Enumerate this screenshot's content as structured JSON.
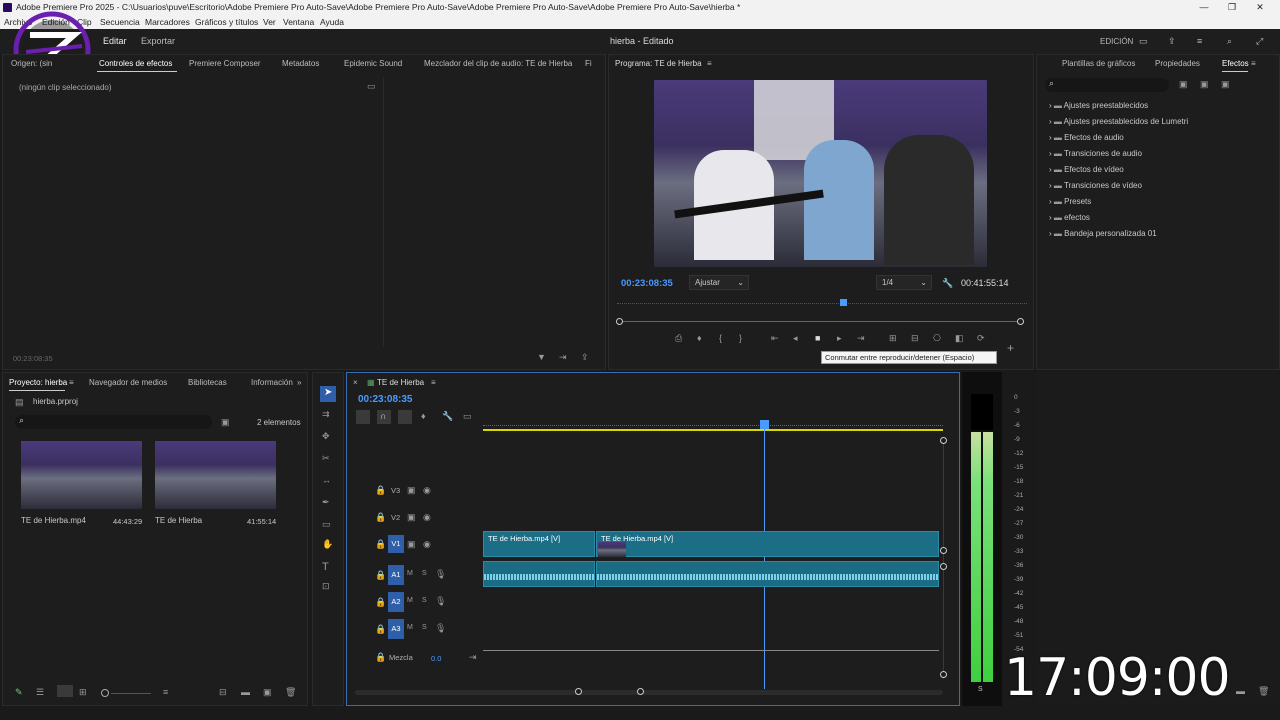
{
  "window": {
    "title": "Adobe Premiere Pro 2025 - C:\\Usuarios\\puve\\Escritorio\\Adobe Premiere Pro Auto-Save\\Adobe Premiere Pro Auto-Save\\Adobe Premiere Pro Auto-Save\\Adobe Premiere Pro Auto-Save\\hierba *",
    "minimize": "—",
    "maximize": "❐",
    "close": "✕"
  },
  "menu": [
    "Archivo",
    "Edición",
    "Clip",
    "Secuencia",
    "Marcadores",
    "Gráficos y títulos",
    "Ver",
    "Ventana",
    "Ayuda"
  ],
  "header": {
    "edit": "Editar",
    "export": "Exportar",
    "project_title": "hierba - Editado",
    "workspace": "EDICIÓN"
  },
  "source_panel": {
    "tabs": [
      "Origen: (sin",
      "Controles de efectos",
      "Premiere Composer",
      "Metadatos",
      "Epidemic Sound",
      "Mezclador del clip de audio: TE de Hierba",
      "Fi"
    ],
    "empty_label": "(ningún clip seleccionado)",
    "timecode": "00:23:08:35"
  },
  "program_monitor": {
    "title": "Programa: TE de Hierba",
    "timecode": "00:23:08:35",
    "fit": "Ajustar",
    "resolution": "1/4",
    "duration": "00:41:55:14",
    "playhead_fraction": 0.55,
    "tooltip": "Conmutar entre reproducir/detener (Espacio)"
  },
  "effects_panel": {
    "tabs": [
      "Plantillas de gráficos",
      "Propiedades",
      "Efectos"
    ],
    "items": [
      "Ajustes preestablecidos",
      "Ajustes preestablecidos de Lumetri",
      "Efectos de audio",
      "Transiciones de audio",
      "Efectos de vídeo",
      "Transiciones de vídeo",
      "Presets",
      "efectos",
      "Bandeja personalizada 01"
    ]
  },
  "project_panel": {
    "tabs": [
      "Proyecto: hierba",
      "Navegador de medios",
      "Bibliotecas",
      "Información"
    ],
    "file": "hierba.prproj",
    "count": "2 elementos",
    "items": [
      {
        "name": "TE de Hierba.mp4",
        "duration": "44:43:29"
      },
      {
        "name": "TE de Hierba",
        "duration": "41:55:14"
      }
    ]
  },
  "timeline": {
    "sequence": "TE de Hierba",
    "timecode": "00:23:08:35",
    "tracks": [
      "V3",
      "V2",
      "V1",
      "A1",
      "A2",
      "A3"
    ],
    "mix_label": "Mezcla",
    "mix_value": "0.0",
    "clip1": "TE de Hierba.mp4 [V]",
    "clip2": "TE de Hierba.mp4 [V]",
    "playhead_fraction": 0.61
  },
  "meter": {
    "labels": [
      "0",
      "-3",
      "-6",
      "-9",
      "-12",
      "-15",
      "-18",
      "-21",
      "-24",
      "-27",
      "-30",
      "-33",
      "-36",
      "-39",
      "-42",
      "-45",
      "-48",
      "-51",
      "-54"
    ],
    "solo": "S"
  },
  "overlay_clock": "17:09:00"
}
